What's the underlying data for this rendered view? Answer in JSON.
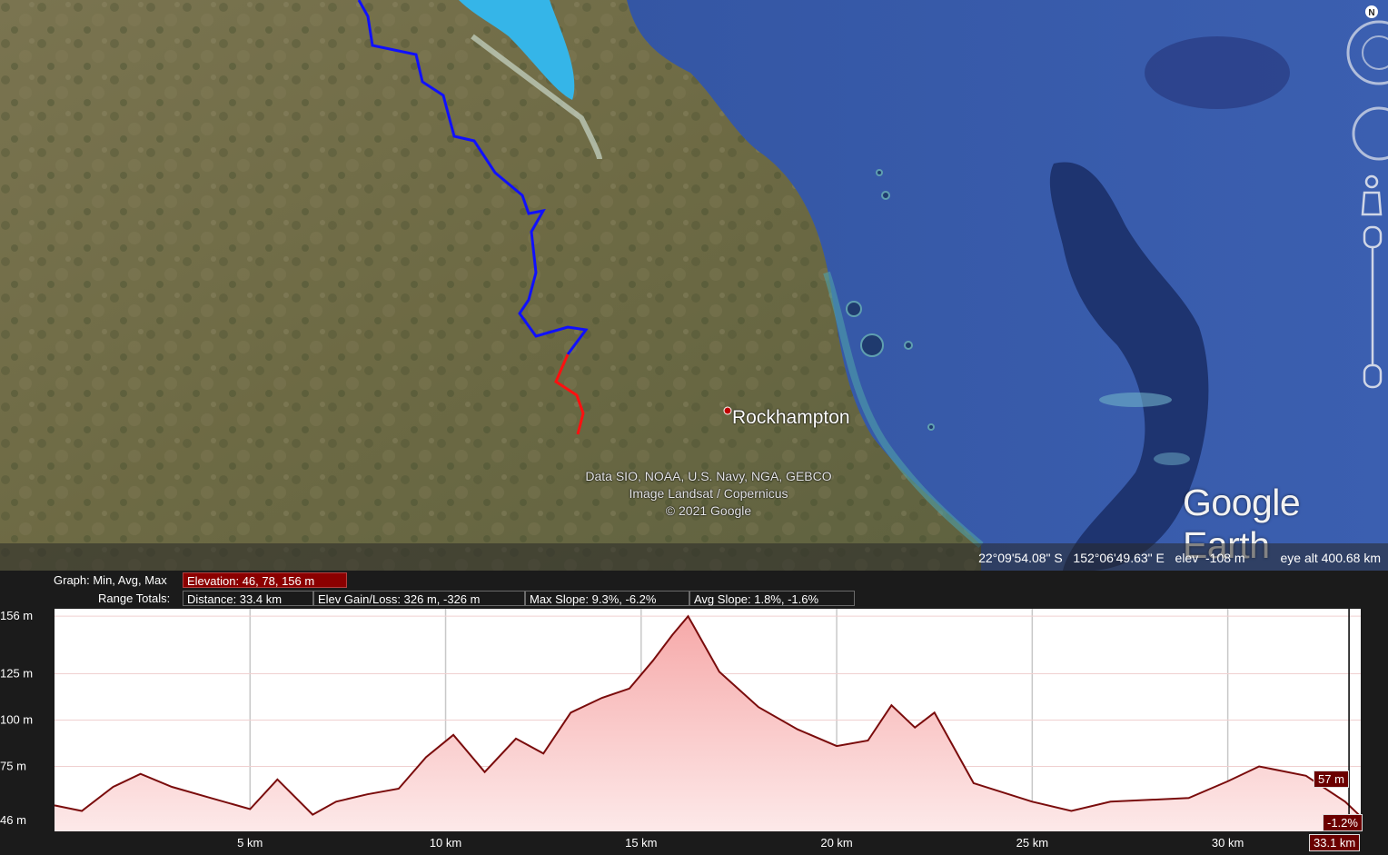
{
  "map": {
    "city": "Rockhampton",
    "attribution": [
      "Data SIO, NOAA, U.S. Navy, NGA, GEBCO",
      "Image Landsat / Copernicus",
      "© 2021 Google"
    ],
    "logo": "Google Earth",
    "compass_label": "N",
    "status": {
      "lat": "22°09'54.08\" S",
      "lon": "152°06'49.63\" E",
      "elev_label": "elev",
      "elev": "-108 m",
      "eye_alt_label": "eye alt",
      "eye_alt": "400.68 km"
    }
  },
  "profile": {
    "graph_label": "Graph: Min, Avg, Max",
    "elevation_stat": "Elevation: 46, 78, 156 m",
    "range_label": "Range Totals:",
    "distance_stat": "Distance: 33.4 km",
    "gain_loss_stat": "Elev Gain/Loss: 326 m, -326 m",
    "max_slope_stat": "Max Slope: 9.3%, -6.2%",
    "avg_slope_stat": "Avg Slope: 1.8%, -1.6%",
    "cursor_elev": "57 m",
    "cursor_slope": "-1.2%",
    "cursor_dist": "33.1 km"
  },
  "chart_data": {
    "type": "area",
    "x": [
      0,
      0.7,
      1.5,
      2.2,
      3,
      4,
      5,
      5.7,
      6.6,
      7.2,
      8,
      8.8,
      9.5,
      10.2,
      11,
      11.8,
      12.5,
      13.2,
      14,
      14.7,
      15.3,
      15.8,
      16.2,
      17,
      18,
      19,
      20,
      20.8,
      21.4,
      22,
      22.5,
      23.5,
      25,
      26,
      27,
      28,
      29,
      30,
      30.8,
      32,
      33,
      33.4
    ],
    "values": [
      54,
      51,
      64,
      71,
      64,
      58,
      52,
      68,
      49,
      56,
      60,
      63,
      80,
      92,
      72,
      90,
      82,
      104,
      112,
      117,
      132,
      146,
      156,
      126,
      107,
      95,
      86,
      89,
      108,
      96,
      104,
      66,
      56,
      51,
      56,
      57,
      58,
      67,
      75,
      70,
      56,
      48
    ],
    "xlabel": "",
    "ylabel": "",
    "x_ticks": [
      "5 km",
      "10 km",
      "15 km",
      "20 km",
      "25 km",
      "30 km"
    ],
    "x_tick_values": [
      5,
      10,
      15,
      20,
      25,
      30
    ],
    "y_ticks": [
      "46 m",
      "75 m",
      "100 m",
      "125 m",
      "156 m"
    ],
    "y_tick_values": [
      46,
      75,
      100,
      125,
      156
    ],
    "xlim": [
      0,
      33.4
    ],
    "ylim": [
      40,
      160
    ],
    "cursor_x": 33.1,
    "grid": true,
    "colors": {
      "line": "#7a0c0c",
      "fill_top": "#f6a9a9",
      "fill_bottom": "#fde9e9",
      "cursor": "#000000"
    }
  }
}
